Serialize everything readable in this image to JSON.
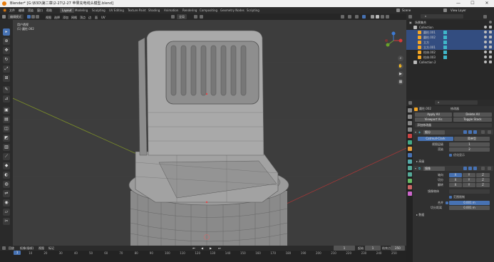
{
  "window": {
    "title": "Blender* [G:\\B3D\\第二章\\2-27\\2-27 苹果充电线头模型.blend]",
    "minimize": "—",
    "maximize": "☐",
    "close": "✕"
  },
  "menu": {
    "items": [
      "文件",
      "编辑",
      "渲染",
      "窗口",
      "帮助"
    ],
    "workspaces": [
      "Layout",
      "Modeling",
      "Sculpting",
      "UV Editing",
      "Texture Paint",
      "Shading",
      "Animation",
      "Rendering",
      "Compositing",
      "Geometry Nodes",
      "Scripting"
    ],
    "active_workspace": "Layout",
    "scene_label": "Scene",
    "view_layer_label": "View Layer"
  },
  "viewport_header": {
    "mode": "编辑模式",
    "menus": [
      "视图",
      "选择",
      "添加",
      "网格",
      "顶点",
      "边",
      "面",
      "UV"
    ],
    "orientation": "全局"
  },
  "viewport": {
    "view_name": "用户透视",
    "object_name": "(1) 圆柱.002"
  },
  "outliner": {
    "header": "场景集合",
    "rows": [
      {
        "label": "Collection",
        "indent": 1,
        "selected": false,
        "icon": "collection-icon"
      },
      {
        "label": "圆柱.001",
        "indent": 2,
        "selected": true,
        "icon": "mesh-icon"
      },
      {
        "label": "圆柱.002",
        "indent": 2,
        "selected": true,
        "icon": "mesh-icon"
      },
      {
        "label": "立方",
        "indent": 2,
        "selected": true,
        "icon": "mesh-icon"
      },
      {
        "label": "立方.001",
        "indent": 2,
        "selected": true,
        "icon": "mesh-icon"
      },
      {
        "label": "柱体.002",
        "indent": 2,
        "selected": false,
        "icon": "mesh-icon"
      },
      {
        "label": "柱体.003",
        "indent": 2,
        "selected": false,
        "icon": "mesh-icon"
      },
      {
        "label": "Collection 2",
        "indent": 1,
        "selected": false,
        "icon": "collection-icon"
      }
    ]
  },
  "properties": {
    "object_name": "圆柱.002",
    "modifier_title": "修改器",
    "apply_all": "Apply All",
    "delete_all": "Delete All",
    "viewport_vis": "Viewport Vis",
    "toggle_stack": "Toggle Stack",
    "add_modifier": "添加修改器",
    "subsurf": {
      "name": "细分",
      "mode_a": "Catmull-Clark",
      "mode_b": "简单型",
      "levels_viewport_label": "视图层级",
      "levels_viewport": "1",
      "render_label": "渲染",
      "render": "2",
      "optimal_label": "优化显示",
      "advanced_label": "高级"
    },
    "mirror": {
      "name": "镜像",
      "axis_label": "轴向",
      "bisect_label": "切分",
      "flip_label": "翻转",
      "axis_x": "X",
      "axis_y": "Y",
      "axis_z": "Z",
      "mirror_object_label": "镜像物体",
      "clipping_label": "范围限制",
      "merge_label": "合并",
      "merge_value": "0.001 m",
      "bisect_dist_label": "切分距离",
      "bisect_dist_value": "0.001 m",
      "data_label": "数据"
    }
  },
  "timeline": {
    "menus": [
      "回放",
      "抠像(插帧)",
      "视图",
      "标记"
    ],
    "current_frame": "1",
    "start_label": "起始",
    "start": "1",
    "end_label": "结束点",
    "end": "250",
    "ticks": [
      "0",
      "10",
      "20",
      "30",
      "40",
      "50",
      "60",
      "70",
      "80",
      "90",
      "100",
      "110",
      "120",
      "130",
      "140",
      "150",
      "160",
      "170",
      "180",
      "190",
      "200",
      "210",
      "220",
      "230",
      "240",
      "250"
    ]
  },
  "colors": {
    "accent": "#4772b3",
    "selected_row": "#334d80",
    "blender_orange": "#e87d0d",
    "mesh_orange": "#f5a623",
    "modifier_cyan": "#3fb7c9",
    "axis_red": "#d63a3a",
    "axis_green": "#6aa32a",
    "axis_blue": "#3d7bd6"
  }
}
